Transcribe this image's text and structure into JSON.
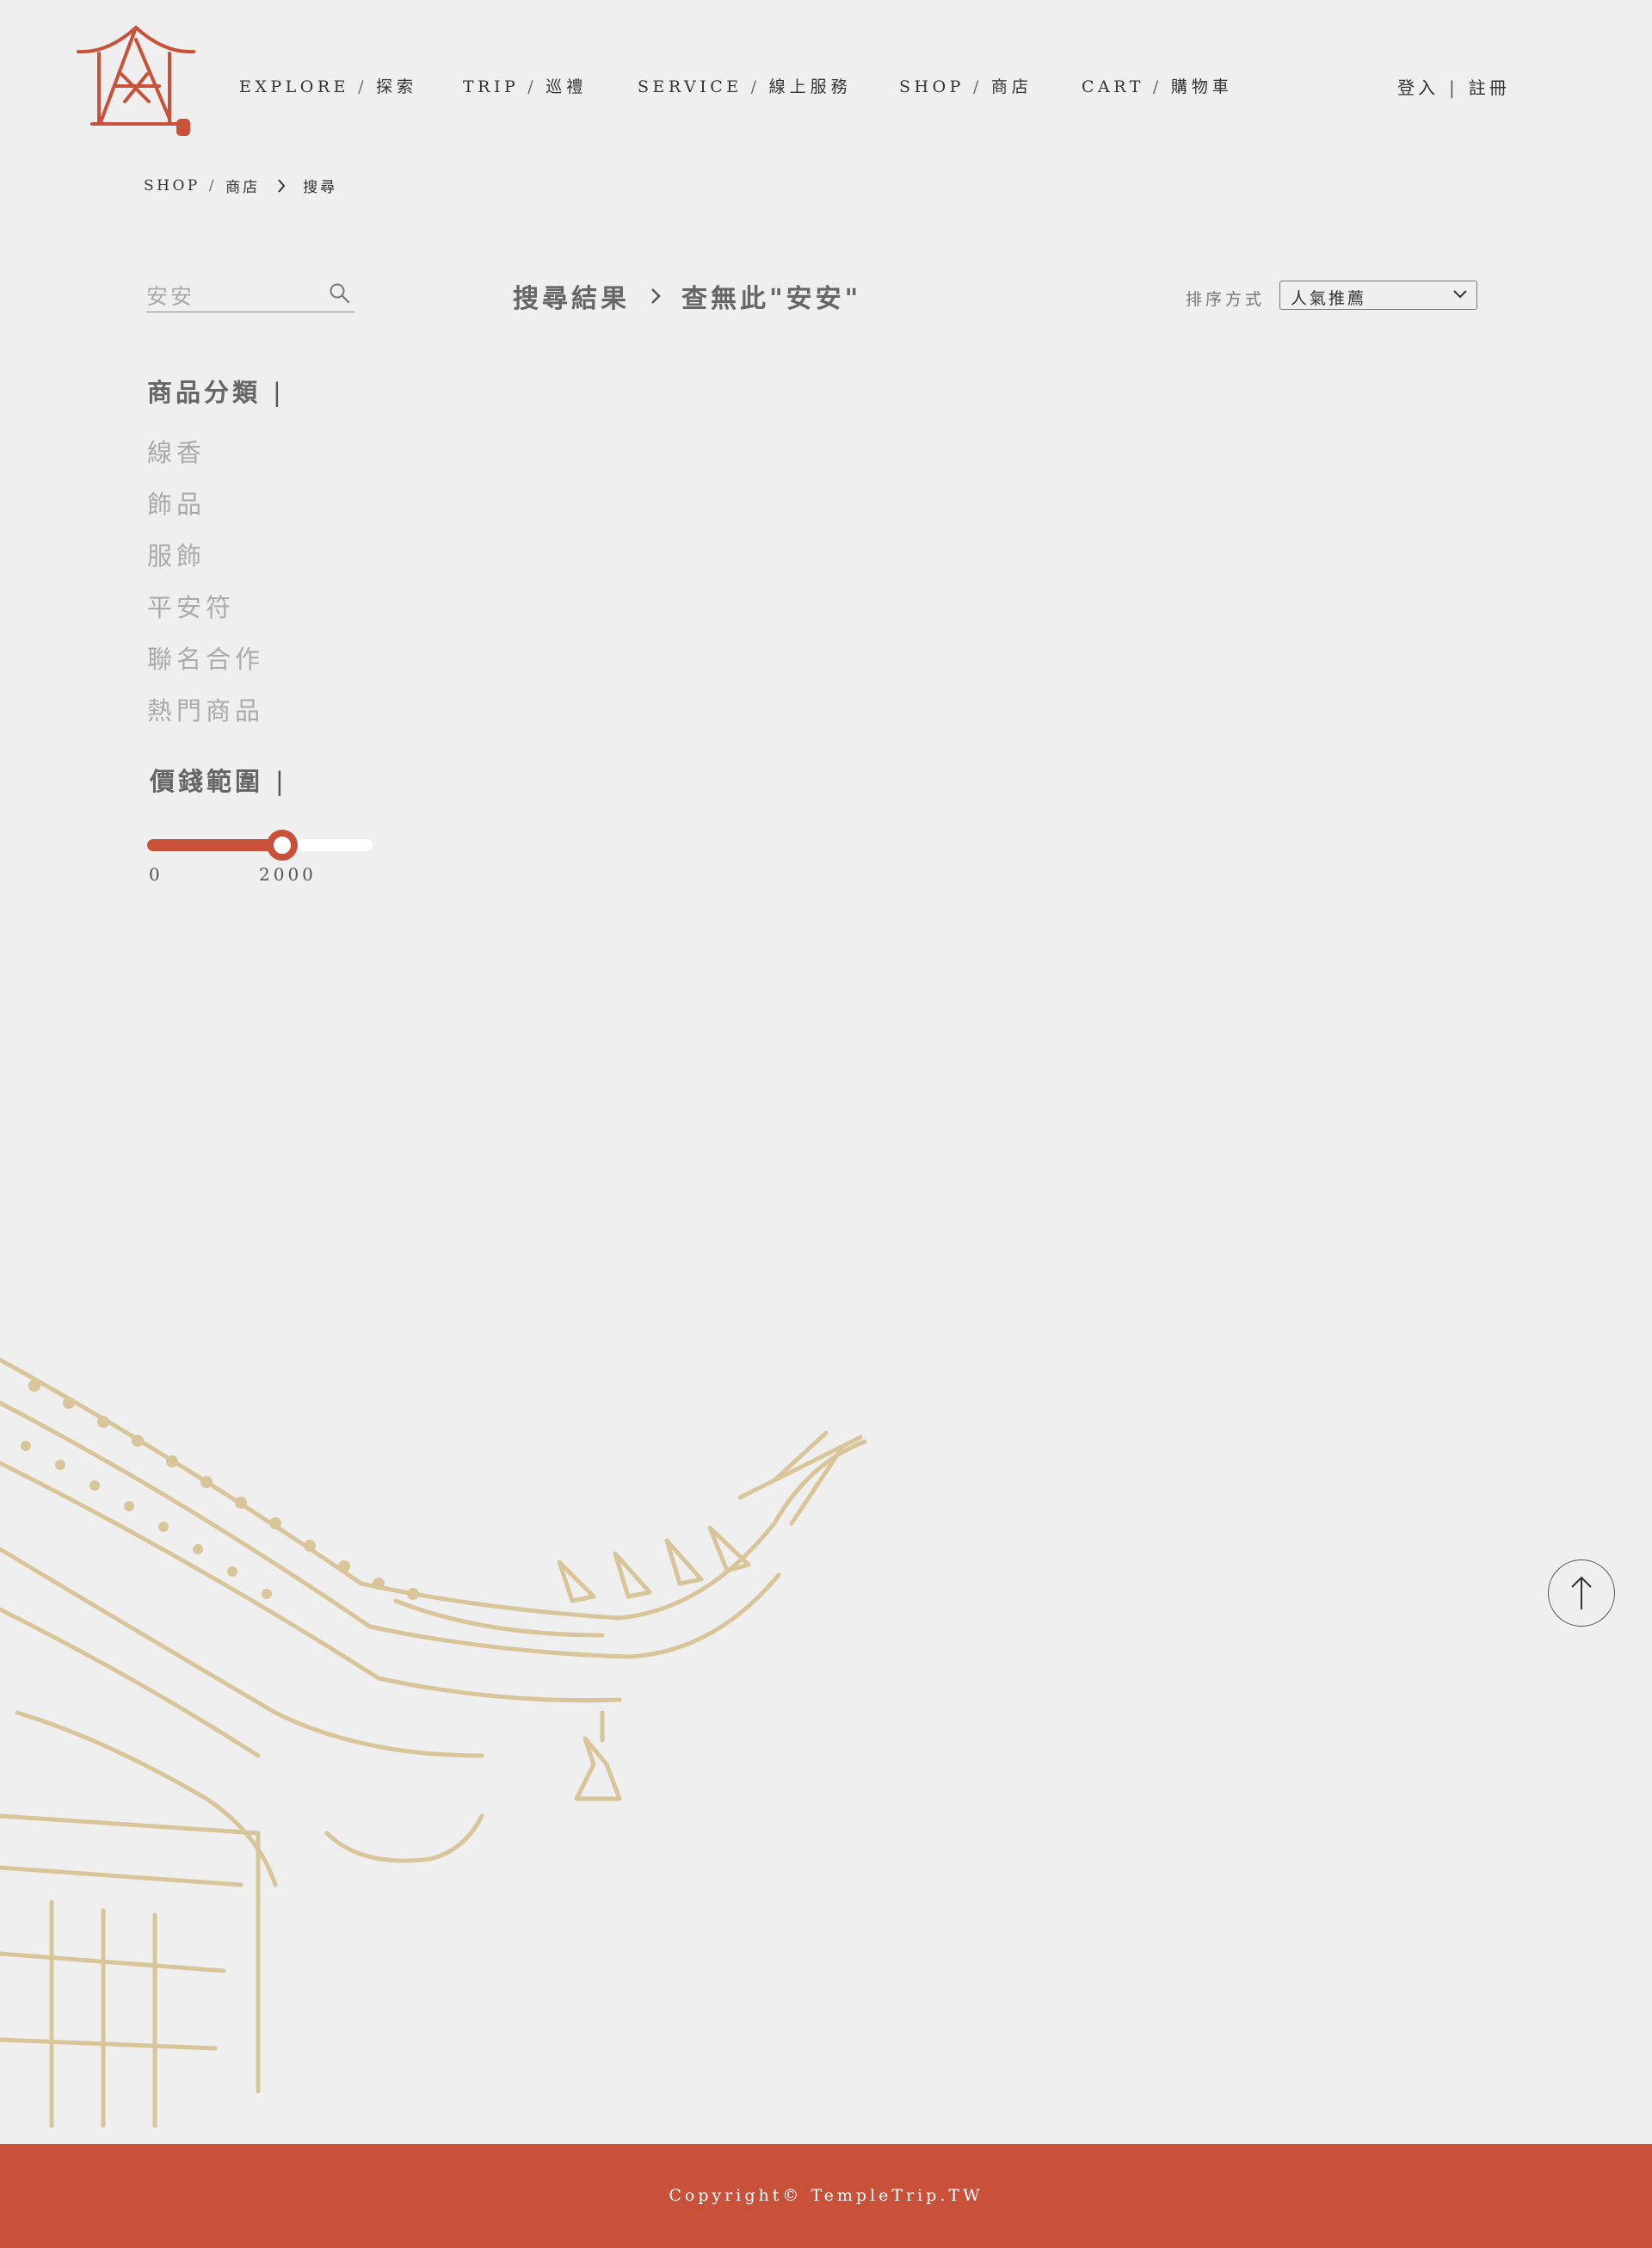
{
  "header": {
    "nav": [
      {
        "en": "EXPLORE",
        "zh": "探索"
      },
      {
        "en": "TRIP",
        "zh": "巡禮"
      },
      {
        "en": "SERVICE",
        "zh": "線上服務"
      },
      {
        "en": "SHOP",
        "zh": "商店"
      },
      {
        "en": "CART",
        "zh": "購物車"
      }
    ],
    "nav_separator": "/",
    "auth": {
      "login": "登入",
      "divider": "|",
      "register": "註冊"
    }
  },
  "breadcrumb": {
    "shop_en": "SHOP",
    "separator": "/",
    "shop_zh": "商店",
    "current": "搜尋"
  },
  "search": {
    "value": "安安",
    "placeholder": "安安"
  },
  "results": {
    "label": "搜尋結果",
    "message": "查無此\"安安\""
  },
  "sort": {
    "label": "排序方式",
    "selected": "人氣推薦"
  },
  "sidebar": {
    "category_heading": "商品分類",
    "heading_divider": "|",
    "categories": [
      "線香",
      "飾品",
      "服飾",
      "平安符",
      "聯名合作",
      "熱門商品"
    ],
    "price_heading": "價錢範圍",
    "price_min": "0",
    "price_max": "2000",
    "price_slider_fraction": 0.6
  },
  "footer": {
    "copyright": "Copyright© TempleTrip.TW"
  },
  "colors": {
    "accent": "#c9513a",
    "background": "#efefef",
    "art": "#d9c59a"
  },
  "icons": {
    "search": "search-icon",
    "sort": "chevron-down-icon",
    "back_to_top": "arrow-up-icon"
  }
}
